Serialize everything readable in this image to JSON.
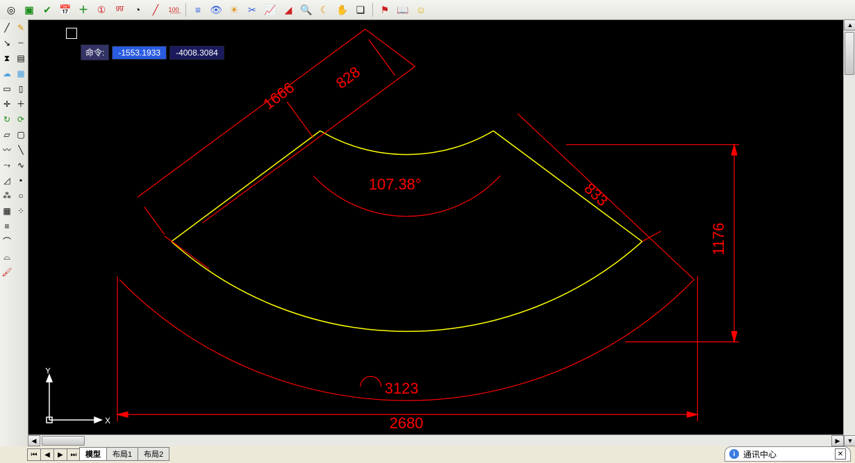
{
  "toolbar_top": {
    "icons": [
      "target-icon",
      "layer-icon",
      "check-icon",
      "calendar-icon",
      "plus-icon",
      "circle1-icon",
      "overline99-icon",
      "protractor-icon",
      "slash-icon",
      "bar100-icon",
      "sep",
      "lines-icon",
      "eye-icon",
      "sun-icon",
      "scissors-icon",
      "graph-icon",
      "slope-icon",
      "zoom-in-icon",
      "moon-icon",
      "hand-icon",
      "page-icon",
      "sep",
      "flag-icon",
      "book-icon",
      "smile-icon"
    ]
  },
  "toolbar_left": {
    "col1": [
      "line-icon",
      "arrow-icon",
      "mirror-icon",
      "cloud-icon",
      "ruler-icon",
      "move-icon",
      "rotate-icon",
      "crop-icon",
      "polyline-icon",
      "path-icon",
      "angle-icon",
      "spray-icon",
      "shapes-icon",
      "bars-icon",
      "curve1-icon",
      "curve2-icon",
      "brush-icon"
    ],
    "col2": [
      "pencil-icon",
      "dash-icon",
      "shade-icon",
      "grid-icon",
      "vruler-icon",
      "plus2-icon",
      "refresh-icon",
      "box-icon",
      "diag-icon",
      "wave-icon",
      "pin-icon",
      "circle-icon",
      "dots-icon"
    ]
  },
  "canvas": {
    "command_label": "命令:",
    "coord_x": "-1553.1933",
    "coord_y": "-4008.3084",
    "dims": {
      "d1666": "1666",
      "d828": "828",
      "angle": "107.38°",
      "d833": "833",
      "d1176": "1176",
      "r3123": "3123",
      "d2680": "2680"
    },
    "axes": {
      "x": "X",
      "y": "Y"
    }
  },
  "tabs": {
    "nav": [
      "⏮",
      "◀",
      "▶",
      "⏭"
    ],
    "items": [
      "模型",
      "布局1",
      "布局2"
    ],
    "active": 0
  },
  "notify": {
    "label": "通讯中心"
  }
}
